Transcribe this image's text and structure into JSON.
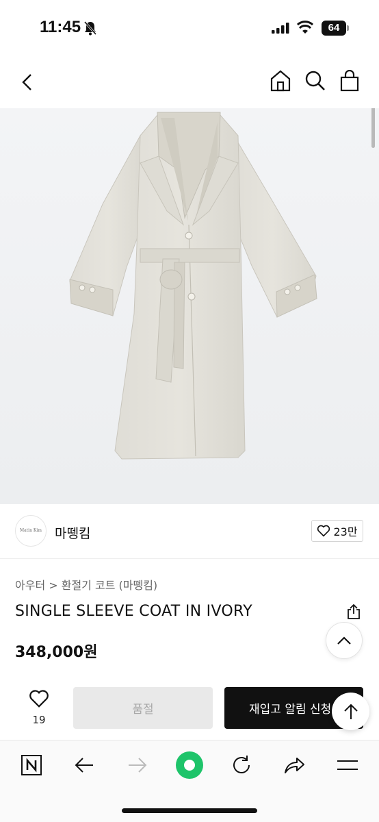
{
  "status_bar": {
    "time": "11:45",
    "battery": "64"
  },
  "product": {
    "breadcrumb": "아우터 > 환절기 코트 (마뗑킴)",
    "title": "SINGLE SLEEVE COAT IN IVORY",
    "price": "348,000원"
  },
  "seller": {
    "name": "마뗑킴",
    "logo_text": "Matin Kim",
    "likes": "23만"
  },
  "actions": {
    "wish_count": "19",
    "soldout_label": "품절",
    "restock_label": "재입고 알림 신청"
  },
  "colors": {
    "restock_bg": "#111111",
    "soldout_bg": "#e9e9e9",
    "browser_accent": "#1ec46a"
  },
  "icons": {
    "header": [
      "back-icon",
      "home-icon",
      "search-icon",
      "shopping-bag-icon"
    ],
    "browser": [
      "naver-n-icon",
      "back-arrow-icon",
      "forward-arrow-icon",
      "green-dot-icon",
      "refresh-icon",
      "share-arrow-icon",
      "menu-icon"
    ]
  }
}
